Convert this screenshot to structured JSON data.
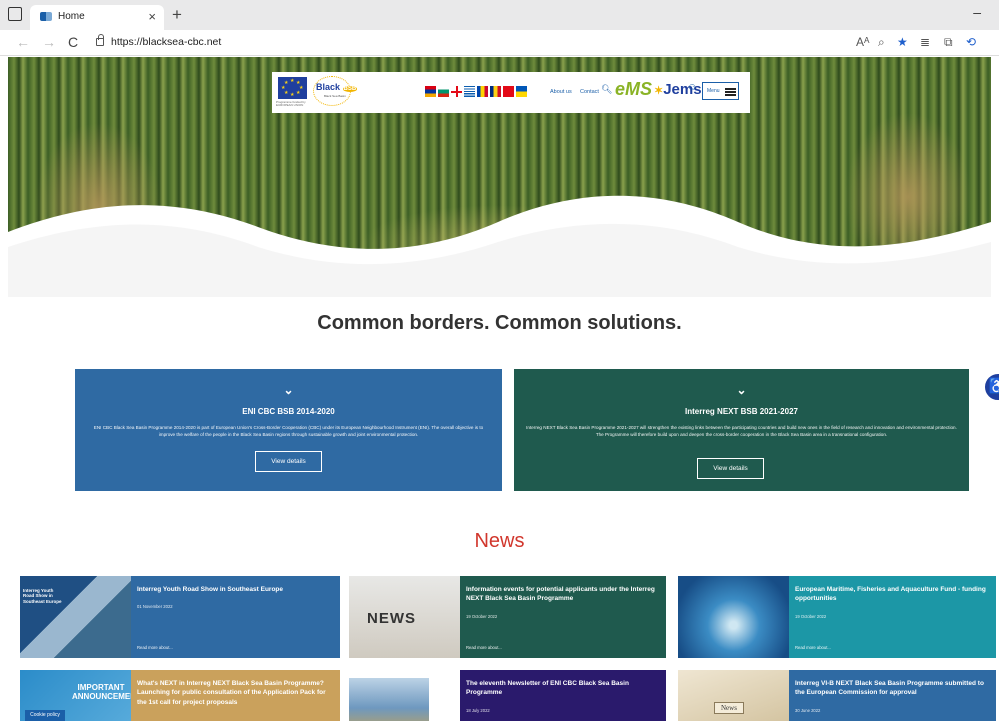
{
  "browser": {
    "tab_title": "Home",
    "tab_close": "×",
    "new_tab": "+",
    "url": "https://blacksea-cbc.net",
    "minimize": "–",
    "nav_back": "←",
    "nav_forward": "→",
    "reload": "C",
    "toolbar_icons": [
      "Aᴬ",
      "⌕",
      "★",
      "≣",
      "⧉",
      "⟲"
    ]
  },
  "header": {
    "eu_text": "Programme funded by EUROPEAN UNION",
    "logo_text": "Black",
    "logo_badge": "BSB",
    "logo_sub": "Black Sea Basin",
    "links": [
      "About us",
      "Contact"
    ],
    "ems": "eMS",
    "jems": "Jems",
    "menu_label": "Menu",
    "accent": "#1b5fa8"
  },
  "slogan": "Common borders. Common solutions.",
  "programmes": [
    {
      "title": "ENI CBC BSB 2014-2020",
      "text": "ENI CBC Black Sea Basin Programme 2014-2020 is part of European Union's Cross-Border Cooperation (CBC) under its European Neighbourhood Instrument (ENI). The overall objective is to improve the welfare of the people in the Black Sea Basin regions through sustainable growth and joint environmental protection.",
      "button": "View details",
      "color": "#2f6aa3"
    },
    {
      "title": "Interreg NEXT BSB 2021-2027",
      "text": "Interreg NEXT Black Sea Basin Programme 2021-2027 will strengthen the existing links between the participating countries and build new ones in the field of research and innovation and environmental protection. The Programme will therefore build upon and deepen the cross-border cooperation in the Black Sea Basin area in a transnational configuration.",
      "button": "View details",
      "color": "#1f5a4e"
    }
  ],
  "news": {
    "title": "News",
    "items": [
      {
        "headline": "Interreg Youth Road Show in Southeast Europe",
        "date": "01 November 2022",
        "more": "Read more about...",
        "color": "#2f6aa3",
        "thumb": "Interreg Youth Road Show in Southeast Europe"
      },
      {
        "headline": "Information events for potential applicants under the Interreg NEXT Black Sea Basin Programme",
        "date": "19 October 2022",
        "more": "Read more about...",
        "color": "#1f5a4e",
        "thumb": "NEWS"
      },
      {
        "headline": "European Maritime, Fisheries and Aquaculture Fund - funding opportunities",
        "date": "19 October 2022",
        "more": "Read more about...",
        "color": "#1c97a6",
        "thumb": ""
      },
      {
        "headline": "What's NEXT in Interreg NEXT Black Sea Basin Programme? Launching for public consultation of the Application Pack for the 1st call for project proposals",
        "date": "",
        "more": "",
        "color": "#caa15c",
        "thumb": "IMPORTANT ANNOUNCEMENT"
      },
      {
        "headline": "The eleventh Newsletter of ENI CBC Black Sea Basin Programme",
        "date": "18 July 2022",
        "more": "",
        "color": "#2a1a6c",
        "thumb": ""
      },
      {
        "headline": "Interreg VI-B NEXT Black Sea Basin Programme submitted to the European Commission for approval",
        "date": "30 June 2022",
        "more": "",
        "color": "#2f6aa3",
        "thumb": "News"
      }
    ]
  },
  "cookie": "Cookie policy"
}
